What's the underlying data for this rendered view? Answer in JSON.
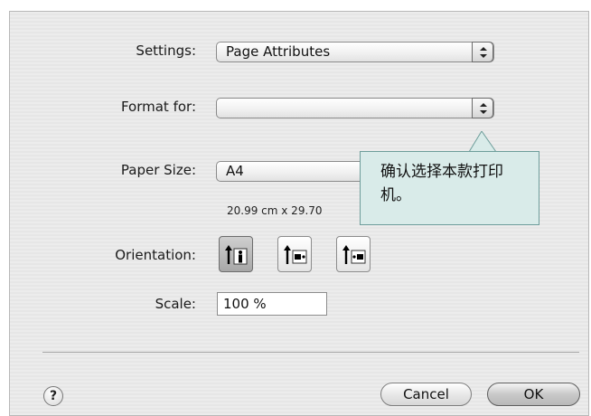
{
  "settings": {
    "label": "Settings:",
    "value": "Page Attributes"
  },
  "format_for": {
    "label": "Format for:",
    "value": ""
  },
  "paper_size": {
    "label": "Paper Size:",
    "value": "A4",
    "detail": "20.99 cm x 29.70"
  },
  "orientation": {
    "label": "Orientation:",
    "options": [
      "portrait-icon",
      "landscape-icon",
      "reverse-landscape-icon"
    ],
    "selected": "portrait-icon"
  },
  "scale": {
    "label": "Scale:",
    "value": "100 %"
  },
  "help": {
    "label": "?"
  },
  "buttons": {
    "cancel": "Cancel",
    "ok": "OK"
  },
  "tooltip": {
    "text": "确认选择本款打印机。"
  }
}
